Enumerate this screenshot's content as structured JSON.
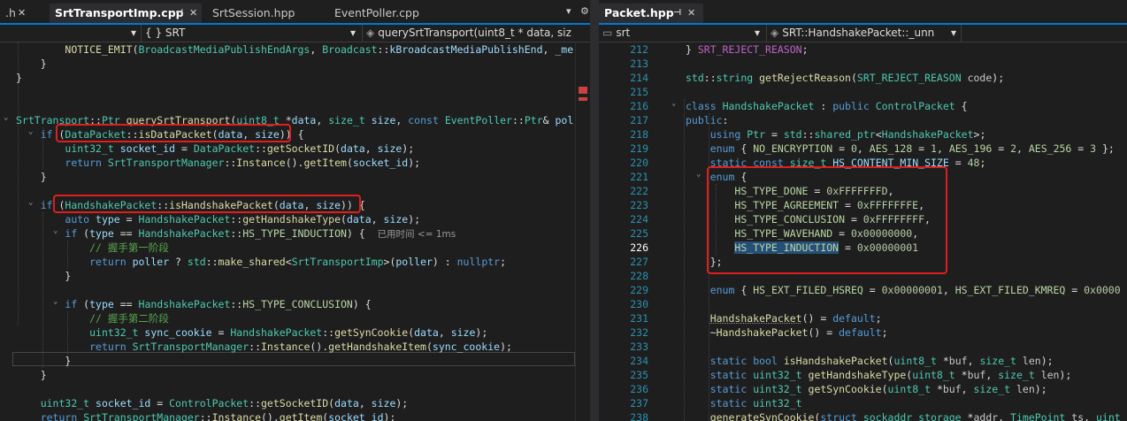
{
  "left": {
    "tabs": [
      {
        "label": ".h",
        "active": false
      },
      {
        "label": "SrtTransportImp.cpp",
        "active": true
      },
      {
        "label": "SrtSession.hpp",
        "active": false
      },
      {
        "label": "EventPoller.cpp",
        "active": false
      }
    ],
    "nav": {
      "scope": "",
      "class": "{ } SRT",
      "function": "querySrtTransport(uint8_t * data, siz"
    },
    "inline_hint": "已用时间 <= 1ms",
    "lines": [
      "        NOTICE_EMIT(BroadcastMediaPublishEndArgs, Broadcast::kBroadcastMediaPublishEnd, _me",
      "    }",
      "}",
      "",
      "",
      "SrtTransport::Ptr querySrtTransport(uint8_t *data, size_t size, const EventPoller::Ptr& pol",
      "    if (DataPacket::isDataPacket(data, size)) {",
      "        uint32_t socket_id = DataPacket::getSocketID(data, size);",
      "        return SrtTransportManager::Instance().getItem(socket_id);",
      "    }",
      "",
      "    if (HandshakePacket::isHandshakePacket(data, size)) {",
      "        auto type = HandshakePacket::getHandshakeType(data, size);",
      "        if (type == HandshakePacket::HS_TYPE_INDUCTION) {",
      "            // 握手第一阶段",
      "            return poller ? std::make_shared<SrtTransportImp>(poller) : nullptr;",
      "        }",
      "",
      "        if (type == HandshakePacket::HS_TYPE_CONCLUSION) {",
      "            // 握手第二阶段",
      "            uint32_t sync_cookie = HandshakePacket::getSynCookie(data, size);",
      "            return SrtTransportManager::Instance().getHandshakeItem(sync_cookie);",
      "        }",
      "    }",
      "",
      "    uint32_t socket_id = ControlPacket::getSocketID(data, size);",
      "    return SrtTransportManager::Instance().getItem(socket_id);"
    ]
  },
  "right": {
    "tabs": [
      {
        "label": "Packet.hpp",
        "active": true
      }
    ],
    "nav": {
      "scope": "srt",
      "class": "SRT::HandshakePacket::_unn"
    },
    "line_numbers": [
      "212",
      "213",
      "214",
      "215",
      "216",
      "217",
      "218",
      "219",
      "220",
      "221",
      "222",
      "223",
      "224",
      "225",
      "226",
      "227",
      "228",
      "229",
      "230",
      "231",
      "232",
      "233",
      "234",
      "235",
      "236",
      "237",
      "238"
    ],
    "current_line": "226",
    "lines": [
      "    } SRT_REJECT_REASON;",
      "",
      "    std::string getRejectReason(SRT_REJECT_REASON code);",
      "",
      "    class HandshakePacket : public ControlPacket {",
      "    public:",
      "        using Ptr = std::shared_ptr<HandshakePacket>;",
      "        enum { NO_ENCRYPTION = 0, AES_128 = 1, AES_196 = 2, AES_256 = 3 };",
      "        static const size_t HS_CONTENT_MIN_SIZE = 48;",
      "        enum {",
      "            HS_TYPE_DONE = 0xFFFFFFFD,",
      "            HS_TYPE_AGREEMENT = 0xFFFFFFFE,",
      "            HS_TYPE_CONCLUSION = 0xFFFFFFFF,",
      "            HS_TYPE_WAVEHAND = 0x00000000,",
      "            HS_TYPE_INDUCTION = 0x00000001",
      "        };",
      "",
      "        enum { HS_EXT_FILED_HSREQ = 0x00000001, HS_EXT_FILED_KMREQ = 0x0000",
      "",
      "        HandshakePacket() = default;",
      "        ~HandshakePacket() = default;",
      "",
      "        static bool isHandshakePacket(uint8_t *buf, size_t len);",
      "        static uint32_t getHandshakeType(uint8_t *buf, size_t len);",
      "        static uint32_t getSynCookie(uint8_t *buf, size_t len);",
      "        static uint32_t",
      "        generateSynCookie(struct sockaddr_storage *addr, TimePoint ts, uint"
    ]
  },
  "colors": {
    "keyword": "#569cd6",
    "type": "#4ec9b0",
    "function": "#dcdcaa",
    "variable": "#9cdcfe",
    "number": "#b5cea8",
    "comment": "#57a64a",
    "highlight_box": "#e01e1e",
    "line_number": "#2b91af",
    "selection": "#264f78"
  },
  "icons": [
    "pin-icon",
    "close-icon",
    "dropdown-icon",
    "gear-icon",
    "collapse-icon"
  ]
}
